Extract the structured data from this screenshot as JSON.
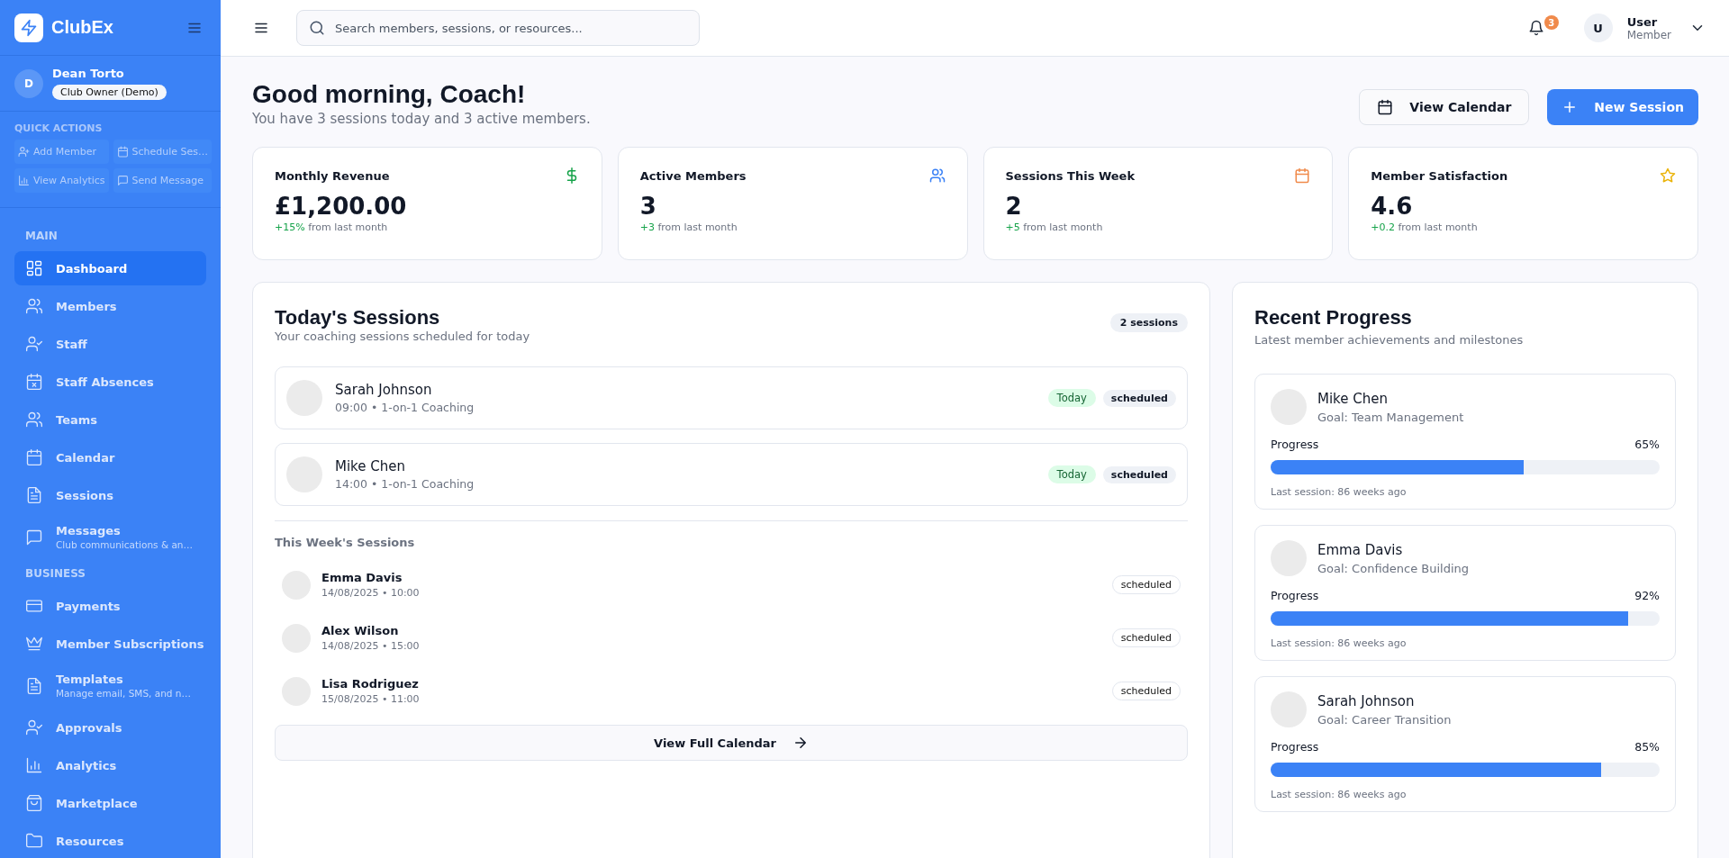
{
  "brand": {
    "name": "ClubEx"
  },
  "user_panel": {
    "initial": "D",
    "name": "Dean Torto",
    "role": "Club Owner (Demo)"
  },
  "quick_actions": {
    "title": "QUICK ACTIONS",
    "items": [
      "Add Member",
      "Schedule Ses…",
      "View Analytics",
      "Send Message"
    ]
  },
  "nav_sections": [
    {
      "title": "MAIN",
      "items": [
        {
          "label": "Dashboard",
          "selected": true
        },
        {
          "label": "Members",
          "selected": false
        },
        {
          "label": "Staff",
          "selected": false
        },
        {
          "label": "Staff Absences",
          "selected": false
        },
        {
          "label": "Teams",
          "selected": false
        },
        {
          "label": "Calendar",
          "selected": false
        },
        {
          "label": "Sessions",
          "selected": false
        },
        {
          "label": "Messages",
          "sub": "Club communications & an…",
          "selected": false
        }
      ]
    },
    {
      "title": "BUSINESS",
      "items": [
        {
          "label": "Payments",
          "selected": false
        },
        {
          "label": "Member Subscriptions",
          "selected": false
        },
        {
          "label": "Templates",
          "sub": "Manage email, SMS, and n…",
          "selected": false
        },
        {
          "label": "Approvals",
          "selected": false
        },
        {
          "label": "Analytics",
          "selected": false
        },
        {
          "label": "Marketplace",
          "selected": false
        },
        {
          "label": "Resources",
          "selected": false
        }
      ]
    }
  ],
  "topbar": {
    "search": {
      "placeholder": "Search members, sessions, or resources..."
    },
    "notification_count": "3",
    "user": {
      "initial": "U",
      "name": "User",
      "role": "Member"
    }
  },
  "greeting": {
    "title": "Good morning, Coach!",
    "subtitle": "You have 3 sessions today and 3 active members."
  },
  "actions": [
    "View Calendar",
    "New Session"
  ],
  "stats": [
    {
      "label": "Monthly Revenue",
      "value": "£1,200.00",
      "change": "+15%",
      "note": "from last month",
      "color": "#16a34a"
    },
    {
      "label": "Active Members",
      "value": "3",
      "change": "+3",
      "note": "from last month",
      "color": "#3b82f6"
    },
    {
      "label": "Sessions This Week",
      "value": "2",
      "change": "+5",
      "note": "from last month",
      "color": "#f08a4b"
    },
    {
      "label": "Member Satisfaction",
      "value": "4.6",
      "change": "+0.2",
      "note": "from last month",
      "color": "#eab308"
    }
  ],
  "todays_sessions": {
    "title": "Today's Sessions",
    "subtitle": "Your coaching sessions scheduled for today",
    "count": "2 sessions",
    "sessions": [
      {
        "name": "Sarah Johnson",
        "detail": "09:00 • 1-on-1 Coaching",
        "tag": "Today",
        "status": "scheduled"
      },
      {
        "name": "Mike Chen",
        "detail": "14:00 • 1-on-1 Coaching",
        "tag": "Today",
        "status": "scheduled"
      }
    ],
    "week_title": "This Week's Sessions",
    "week": [
      {
        "name": "Emma Davis",
        "detail": "14/08/2025 • 10:00",
        "status": "scheduled"
      },
      {
        "name": "Alex Wilson",
        "detail": "14/08/2025 • 15:00",
        "status": "scheduled"
      },
      {
        "name": "Lisa Rodriguez",
        "detail": "15/08/2025 • 11:00",
        "status": "scheduled"
      }
    ],
    "button": "View Full Calendar"
  },
  "recent_progress": {
    "title": "Recent Progress",
    "subtitle": "Latest member achievements and milestones",
    "items": [
      {
        "name": "Mike Chen",
        "goal": "Goal: Team Management",
        "label": "Progress",
        "percent": "65%",
        "level": 0.65,
        "last": "Last session: 86 weeks ago"
      },
      {
        "name": "Emma Davis",
        "goal": "Goal: Confidence Building",
        "label": "Progress",
        "percent": "92%",
        "level": 0.92,
        "last": "Last session: 86 weeks ago"
      },
      {
        "name": "Sarah Johnson",
        "goal": "Goal: Career Transition",
        "label": "Progress",
        "percent": "85%",
        "level": 0.85,
        "last": "Last session: 86 weeks ago"
      }
    ]
  }
}
